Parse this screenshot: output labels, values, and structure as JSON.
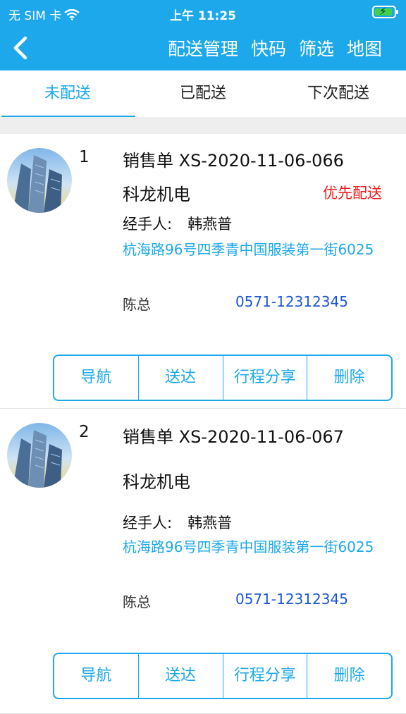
{
  "status_bar": {
    "carrier": "无 SIM 卡",
    "time": "上午 11:25",
    "wifi_icon": "wifi-icon",
    "battery_icon": "battery-charging-icon"
  },
  "nav": {
    "back_icon": "chevron-left-icon",
    "title": "配送管理",
    "actions": [
      "快码",
      "筛选",
      "地图"
    ]
  },
  "tabs": [
    {
      "label": "未配送",
      "active": true
    },
    {
      "label": "已配送",
      "active": false
    },
    {
      "label": "下次配送",
      "active": false
    }
  ],
  "colors": {
    "accent": "#1ca8ea",
    "priority": "#ee1b1b",
    "phone": "#1d56d6"
  },
  "orders": [
    {
      "index": "1",
      "order_no": "销售单 XS-2020-11-06-066",
      "company": "科龙机电",
      "priority": "优先配送",
      "handler_label": "经手人:",
      "handler_name": "韩燕普",
      "address": "杭海路96号四季青中国服装第一街6025",
      "contact": "陈总",
      "phone": "0571-12312345",
      "actions": [
        "导航",
        "送达",
        "行程分享",
        "删除"
      ]
    },
    {
      "index": "2",
      "order_no": "销售单 XS-2020-11-06-067",
      "company": "科龙机电",
      "priority": "",
      "handler_label": "经手人:",
      "handler_name": "韩燕普",
      "address": "杭海路96号四季青中国服装第一街6025",
      "contact": "陈总",
      "phone": "0571-12312345",
      "actions": [
        "导航",
        "送达",
        "行程分享",
        "删除"
      ]
    }
  ]
}
